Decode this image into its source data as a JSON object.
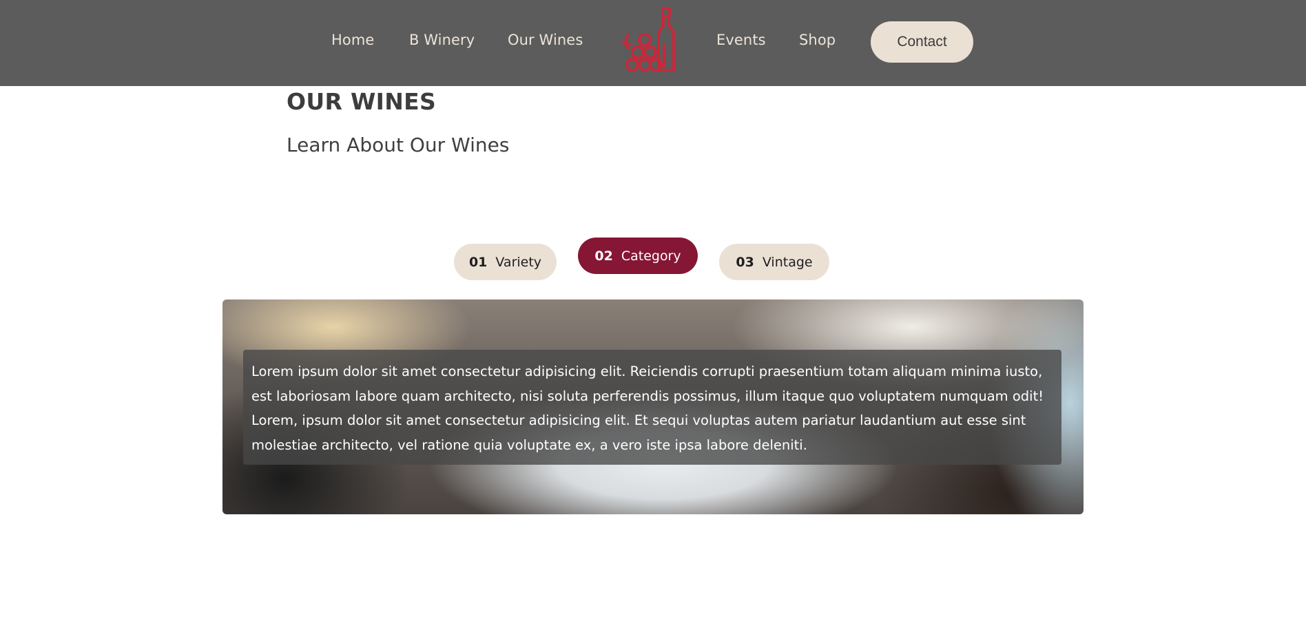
{
  "nav": {
    "links": [
      "Home",
      "B Winery",
      "Our Wines",
      "Events",
      "Shop"
    ],
    "contact_label": "Contact",
    "logo_icon": "wine-bottle-grapes-icon",
    "logo_color": "#c8283a"
  },
  "header": {
    "title": "OUR WINES",
    "subtitle": "Learn About Our Wines"
  },
  "tabs": [
    {
      "number": "01",
      "label": "Variety",
      "active": false
    },
    {
      "number": "02",
      "label": "Category",
      "active": true
    },
    {
      "number": "03",
      "label": "Vintage",
      "active": false
    }
  ],
  "hero": {
    "text": "Lorem ipsum dolor sit amet consectetur adipisicing elit. Reiciendis corrupti praesentium totam aliquam minima iusto, est laboriosam labore quam architecto, nisi soluta perferendis possimus, illum itaque quo voluptatem numquam odit! Lorem, ipsum dolor sit amet consectetur adipisicing elit. Et sequi voluptas autem pariatur laudantium aut esse sint molestiae architecto, vel ratione quia voluptate ex, a vero iste ipsa labore deleniti."
  },
  "colors": {
    "navbar_bg": "#5c5c5c",
    "tab_active": "#851634",
    "tab_inactive": "#ebe0d4"
  }
}
